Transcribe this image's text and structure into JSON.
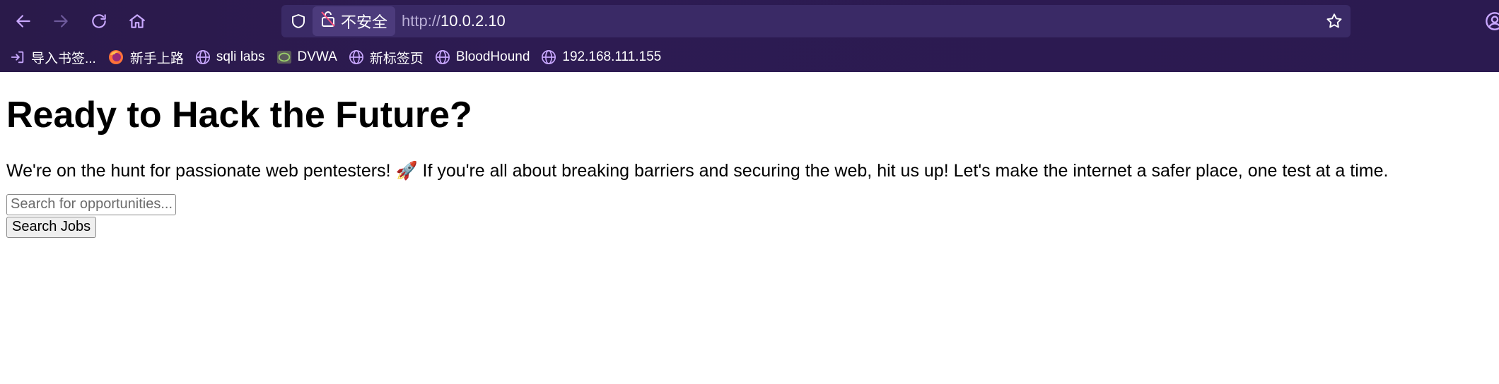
{
  "browser": {
    "nav": {
      "back_icon": "arrow-left-icon",
      "forward_icon": "arrow-right-icon",
      "reload_icon": "reload-icon",
      "home_icon": "home-icon"
    },
    "urlbar": {
      "security_label": "不安全",
      "url_protocol": "http://",
      "url_host": "10.0.2.10"
    },
    "bookmarks": [
      {
        "label": "导入书签...",
        "icon": "import-icon"
      },
      {
        "label": "新手上路",
        "icon": "firefox-icon"
      },
      {
        "label": "sqli labs",
        "icon": "globe-icon"
      },
      {
        "label": "DVWA",
        "icon": "dvwa-icon"
      },
      {
        "label": "新标签页",
        "icon": "globe-icon"
      },
      {
        "label": "BloodHound",
        "icon": "globe-icon"
      },
      {
        "label": "192.168.111.155",
        "icon": "globe-icon"
      }
    ],
    "colors": {
      "chrome_bg": "#2a1a4a",
      "urlbar_bg": "#3a2a66",
      "accent": "#c49cff"
    }
  },
  "page": {
    "heading": "Ready to Hack the Future?",
    "intro": "We're on the hunt for passionate web pentesters! 🚀 If you're all about breaking barriers and securing the web, hit us up! Let's make the internet a safer place, one test at a time.",
    "search": {
      "placeholder": "Search for opportunities...",
      "value": ""
    },
    "search_button": "Search Jobs"
  }
}
